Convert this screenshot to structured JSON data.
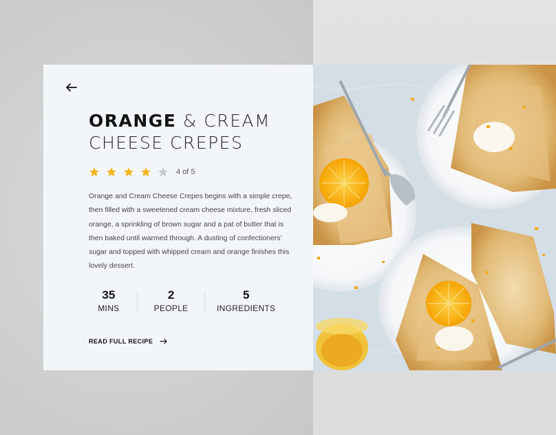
{
  "recipe": {
    "title_bold": "ORANGE",
    "title_rest_line1": "& CREAM",
    "title_line2": "CHEESE CREPES",
    "rating_value": 4,
    "rating_max": 5,
    "rating_text": "4 of 5",
    "description": "Orange and Cream Cheese Crepes begins with a simple crepe, then filled with a sweetened cream cheese mixture, fresh sliced orange, a sprinkling of brown sugar and a pat of butter that is then baked until warmed through. A dusting of confectioners' sugar and topped with whipped cream and orange finishes this lovely dessert.",
    "stats": [
      {
        "value": "35",
        "label": "MINS"
      },
      {
        "value": "2",
        "label": "PEOPLE"
      },
      {
        "value": "5",
        "label": "INGREDIENTS"
      }
    ],
    "read_more_label": "READ FULL RECIPE"
  },
  "icons": {
    "back": "arrow-left-icon",
    "star": "star-icon",
    "read_more": "arrow-right-icon"
  },
  "colors": {
    "star_filled": "#f5b51f",
    "star_empty": "#c5cbd2",
    "card_bg": "#f3f6f9"
  }
}
